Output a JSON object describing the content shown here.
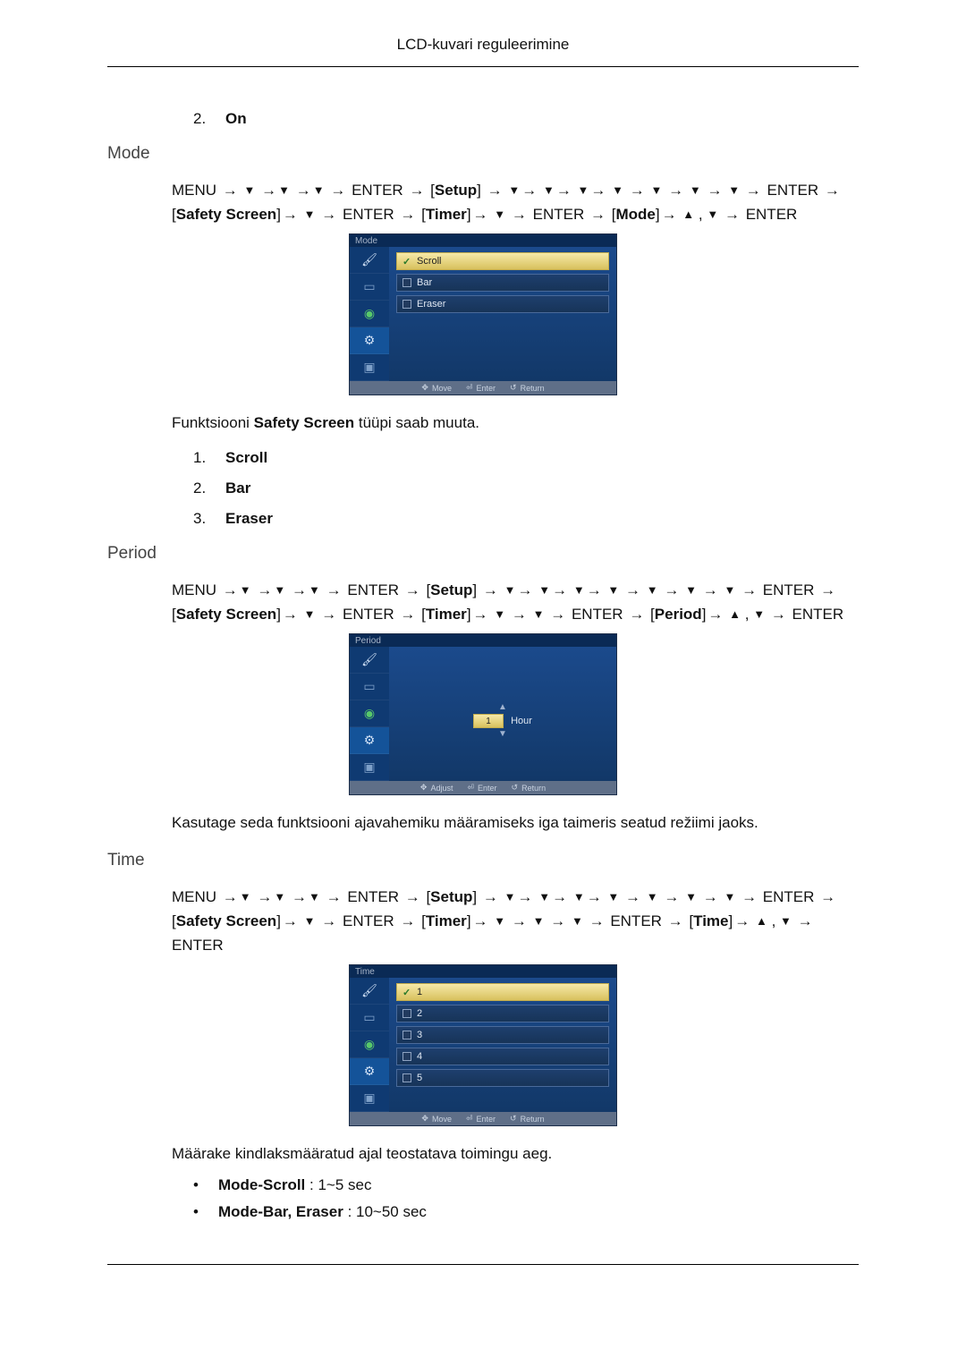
{
  "header": {
    "title": "LCD-kuvari reguleerimine"
  },
  "glyph": {
    "arrow": "→",
    "down": "▼",
    "up": "▲"
  },
  "pre_list": {
    "num": "2.",
    "label": "On"
  },
  "sections": {
    "mode": {
      "heading": "Mode",
      "nav": {
        "menu": "MENU",
        "enter": "ENTER",
        "setup": "Setup",
        "safety": "Safety Screen",
        "timer": "Timer",
        "target": "Mode"
      },
      "osd": {
        "title": "Mode",
        "options": [
          "Scroll",
          "Bar",
          "Eraser"
        ],
        "selected": 0,
        "footer": {
          "move": "Move",
          "enter": "Enter",
          "return": "Return"
        }
      },
      "caption_pre": "Funktsiooni ",
      "caption_bold": "Safety Screen",
      "caption_post": " tüüpi saab muuta.",
      "list": [
        {
          "num": "1.",
          "label": "Scroll"
        },
        {
          "num": "2.",
          "label": "Bar"
        },
        {
          "num": "3.",
          "label": "Eraser"
        }
      ]
    },
    "period": {
      "heading": "Period",
      "nav": {
        "menu": "MENU",
        "enter": "ENTER",
        "setup": "Setup",
        "safety": "Safety Screen",
        "timer": "Timer",
        "target": "Period"
      },
      "osd": {
        "title": "Period",
        "value": "1",
        "unit": "Hour",
        "footer": {
          "adjust": "Adjust",
          "enter": "Enter",
          "return": "Return"
        }
      },
      "caption": "Kasutage seda funktsiooni ajavahemiku määramiseks iga taimeris seatud režiimi jaoks."
    },
    "time": {
      "heading": "Time",
      "nav": {
        "menu": "MENU",
        "enter": "ENTER",
        "setup": "Setup",
        "safety": "Safety Screen",
        "timer": "Timer",
        "target": "Time"
      },
      "osd": {
        "title": "Time",
        "options": [
          "1",
          "2",
          "3",
          "4",
          "5"
        ],
        "selected": 0,
        "footer": {
          "move": "Move",
          "enter": "Enter",
          "return": "Return"
        }
      },
      "caption": "Määrake kindlaksmääratud ajal teostatava toimingu aeg.",
      "bullets": [
        {
          "bold": "Mode-Scroll",
          "rest": " : 1~5 sec"
        },
        {
          "bold": "Mode-Bar, Eraser",
          "rest": " : 10~50 sec"
        }
      ]
    }
  }
}
